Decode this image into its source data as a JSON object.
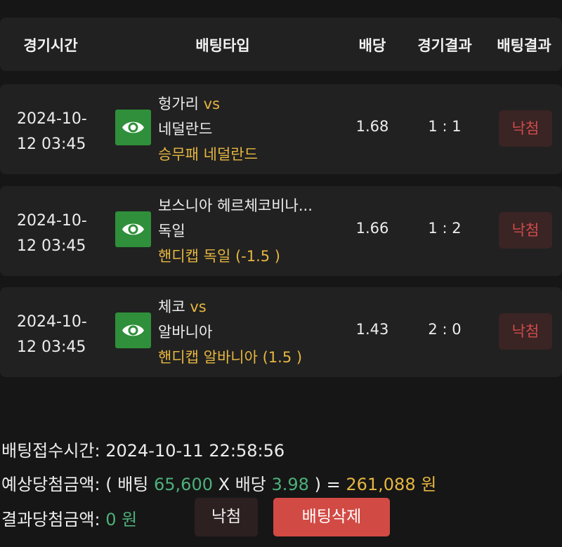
{
  "header": {
    "col_time": "경기시간",
    "col_bet_type": "배팅타입",
    "col_odds": "배당",
    "col_game_result": "경기결과",
    "col_bet_result": "배팅결과"
  },
  "bets": [
    {
      "time_date": "2024-10-",
      "time_rest": "12 03:45",
      "home": "헝가리",
      "vs": "vs",
      "away": "네덜란드",
      "pick": "승무패 네덜란드",
      "odds": "1.68",
      "score": "1 : 1",
      "result": "낙첨"
    },
    {
      "time_date": "2024-10-",
      "time_rest": "12 03:45",
      "home": "보스니아 헤르체코비나...",
      "vs": "",
      "away": "독일",
      "pick": "핸디캡 독일 (-1.5 )",
      "odds": "1.66",
      "score": "1 : 2",
      "result": "낙첨"
    },
    {
      "time_date": "2024-10-",
      "time_rest": "12 03:45",
      "home": "체코",
      "vs": "vs",
      "away": "알바니아",
      "pick": "핸디캡 알바니아 (1.5 )",
      "odds": "1.43",
      "score": "2 : 0",
      "result": "낙첨"
    }
  ],
  "summary": {
    "received_label": "배팅접수시간:",
    "received_value": "2024-10-11 22:58:56",
    "expected_label": "예상당첨금액:",
    "expected_open": "( 배팅",
    "bet_amount": "65,600",
    "times": "X 배당",
    "total_odds": "3.98",
    "close_eq": ") =",
    "expected_win": "261,088 원",
    "result_label": "결과당첨금액:",
    "result_value": "0 원",
    "result_button": "낙첨",
    "delete_button": "배팅삭제"
  },
  "colors": {
    "accent_gold": "#e6b640",
    "accent_green": "#4db07a",
    "lose_red": "#d24b4b",
    "eye_button": "#2f8f3a"
  }
}
